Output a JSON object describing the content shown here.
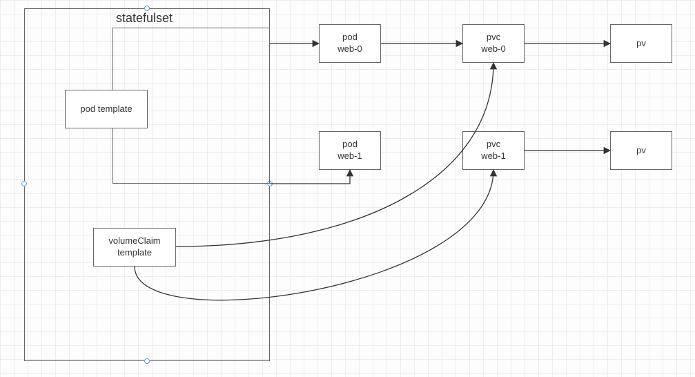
{
  "diagram": {
    "statefulset_title": "statefulset",
    "pod_template": "pod template",
    "volumeclaim_template_l1": "volumeClaim",
    "volumeclaim_template_l2": "template",
    "pod0_l1": "pod",
    "pod0_l2": "web-0",
    "pod1_l1": "pod",
    "pod1_l2": "web-1",
    "pvc0_l1": "pvc",
    "pvc0_l2": "web-0",
    "pvc1_l1": "pvc",
    "pvc1_l2": "web-1",
    "pv0": "pv",
    "pv1": "pv"
  }
}
